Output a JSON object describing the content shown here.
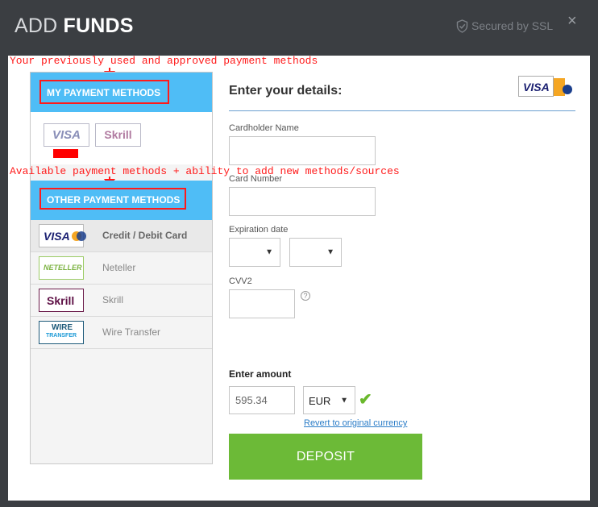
{
  "header": {
    "title_light": "ADD",
    "title_bold": "FUNDS",
    "ssl_label": "Secured by SSL",
    "close_glyph": "×"
  },
  "annotations": {
    "top": "Your previously used and approved payment methods",
    "middle": "Available payment methods + ability to add new methods/sources"
  },
  "my_methods": {
    "heading": "MY PAYMENT METHODS",
    "saved": [
      {
        "label": "VISA",
        "icon": "visa-logo"
      },
      {
        "label": "Skrill",
        "icon": "skrill-logo"
      }
    ]
  },
  "other_methods": {
    "heading": "OTHER PAYMENT METHODS",
    "items": [
      {
        "label": "Credit / Debit Card",
        "logo_text": "VISA",
        "icon": "visa-mastercard-logo",
        "active": true
      },
      {
        "label": "Neteller",
        "logo_text": "NETELLER",
        "icon": "neteller-logo",
        "active": false
      },
      {
        "label": "Skrill",
        "logo_text": "Skrill",
        "icon": "skrill-logo",
        "active": false
      },
      {
        "label": "Wire Transfer",
        "logo_text_1": "WIRE",
        "logo_text_2": "TRANSFER",
        "icon": "wire-transfer-logo",
        "active": false
      }
    ]
  },
  "form": {
    "title": "Enter your details:",
    "card_logo_text": "VISA",
    "cardholder_label": "Cardholder Name",
    "cardholder_value": "",
    "card_number_label": "Card Number",
    "card_number_value": "",
    "expiration_label": "Expiration date",
    "exp_month_value": "",
    "exp_year_value": "",
    "cvv_label": "CVV2",
    "cvv_value": "",
    "help_glyph": "?",
    "amount_label": "Enter amount",
    "amount_value": "595.34",
    "currency_value": "EUR",
    "revert_link": "Revert to original currency",
    "deposit_label": "DEPOSIT"
  },
  "colors": {
    "background": "#3b3e42",
    "section_header": "#4fbdf6",
    "deposit": "#6cba37",
    "annotation": "#ff1a1a",
    "link": "#2a7cc7"
  }
}
